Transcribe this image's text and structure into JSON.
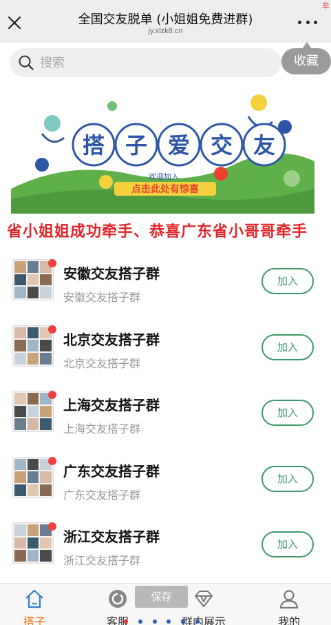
{
  "topbar": {
    "title": "全国交友脱单 (小姐姐免费进群)",
    "url": "jy.xlzk8.cn",
    "corner_mark": "牟"
  },
  "search": {
    "placeholder": "搜索",
    "favorite_label": "收藏"
  },
  "banner": {
    "title_chars": [
      "搭",
      "子",
      "爱",
      "交",
      "友"
    ],
    "welcome": "欢迎加入",
    "cta": "点击此处有惊喜",
    "colors": {
      "sky": "#ffffff",
      "hill": "#5fb04a",
      "title": "#2d56a8",
      "cta": "#e8412f",
      "ribbon": "#f4d13d"
    }
  },
  "marquee": {
    "text": "省小姐姐成功牵手、恭喜广东省小哥哥牵手"
  },
  "groups": [
    {
      "name": "安徽交友搭子群",
      "desc": "安徽交友搭子群",
      "join": "加入"
    },
    {
      "name": "北京交友搭子群",
      "desc": "北京交友搭子群",
      "join": "加入"
    },
    {
      "name": "上海交友搭子群",
      "desc": "上海交友搭子群",
      "join": "加入"
    },
    {
      "name": "广东交友搭子群",
      "desc": "广东交友搭子群",
      "join": "加入"
    },
    {
      "name": "浙江交友搭子群",
      "desc": "浙江交友搭子群",
      "join": "加入"
    }
  ],
  "tabs": [
    {
      "label": "搭子",
      "icon": "home-icon",
      "active": true
    },
    {
      "label": "客服",
      "icon": "service-icon",
      "active": false
    },
    {
      "label": "群内展示",
      "icon": "diamond-icon",
      "active": false
    },
    {
      "label": "我的",
      "icon": "user-icon",
      "active": false
    }
  ],
  "overlay": {
    "save_label": "保存"
  },
  "colors": {
    "accent_green": "#3a9a6a",
    "tab_active": "#ff6a00",
    "unread_dot": "#f04040",
    "marquee_red": "#e4252a"
  }
}
